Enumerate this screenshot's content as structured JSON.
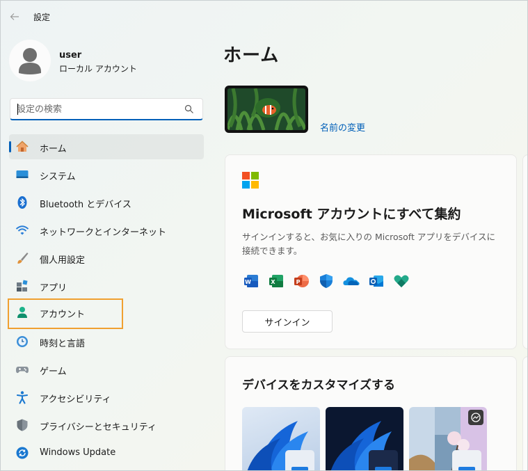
{
  "window": {
    "title": "設定"
  },
  "profile": {
    "name": "user",
    "account_type": "ローカル アカウント"
  },
  "search": {
    "placeholder": "設定の検索"
  },
  "nav": {
    "items": [
      {
        "label": "ホーム",
        "icon": "home-icon"
      },
      {
        "label": "システム",
        "icon": "system-icon"
      },
      {
        "label": "Bluetooth とデバイス",
        "icon": "bluetooth-icon"
      },
      {
        "label": "ネットワークとインターネット",
        "icon": "wifi-icon"
      },
      {
        "label": "個人用設定",
        "icon": "brush-icon"
      },
      {
        "label": "アプリ",
        "icon": "apps-icon"
      },
      {
        "label": "アカウント",
        "icon": "account-icon"
      },
      {
        "label": "時刻と言語",
        "icon": "clock-globe-icon"
      },
      {
        "label": "ゲーム",
        "icon": "gamepad-icon"
      },
      {
        "label": "アクセシビリティ",
        "icon": "accessibility-icon"
      },
      {
        "label": "プライバシーとセキュリティ",
        "icon": "shield-icon"
      },
      {
        "label": "Windows Update",
        "icon": "update-icon"
      }
    ],
    "active_index": 0,
    "highlighted_index": 6
  },
  "main": {
    "title": "ホーム",
    "rename_link": "名前の変更",
    "ms_card": {
      "title": "Microsoft アカウントにすべて集約",
      "description": "サインインすると、お気に入りの Microsoft アプリをデバイスに接続できます。",
      "apps": [
        "word-icon",
        "excel-icon",
        "powerpoint-icon",
        "defender-icon",
        "onedrive-icon",
        "outlook-icon",
        "family-icon"
      ],
      "signin_label": "サインイン"
    },
    "customize_card": {
      "title": "デバイスをカスタマイズする"
    }
  },
  "colors": {
    "accent": "#005fb8",
    "highlight_box": "#f0a030"
  }
}
